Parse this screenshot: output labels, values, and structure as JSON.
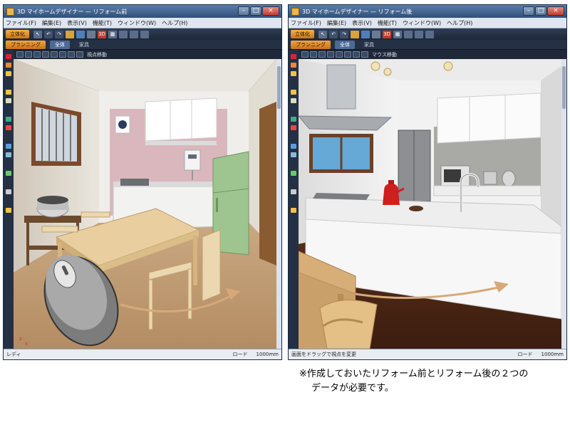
{
  "window_left": {
    "title": "3D マイホームデザイナー — リフォーム前",
    "menu": [
      "ファイル(F)",
      "編集(E)",
      "表示(V)",
      "機能(T)",
      "ウィンドウ(W)",
      "ヘルプ(H)"
    ],
    "mode_button": "立体化",
    "tabs": [
      "プランニング",
      "全体",
      "家具"
    ],
    "view_label": "視点移動",
    "status": "レディ",
    "status_mode": "ロード",
    "status_unit": "1000mm"
  },
  "window_right": {
    "title": "3D マイホームデザイナー — リフォーム後",
    "menu": [
      "ファイル(F)",
      "編集(E)",
      "表示(V)",
      "機能(T)",
      "ウィンドウ(W)",
      "ヘルプ(H)"
    ],
    "mode_button": "立体化",
    "tabs": [
      "プランニング",
      "全体",
      "家具"
    ],
    "view_label": "マウス移動",
    "status": "画面をドラッグで視点を変更",
    "status_mode": "ロード",
    "status_unit": "1000mm"
  },
  "caption": {
    "line1": "※作成しておいたリフォーム前とリフォーム後の２つの",
    "line2": "データが必要です。"
  },
  "colors": {
    "chrome_dark": "#1c2533",
    "title_blue": "#3f6592",
    "accent_orange": "#e89a32"
  }
}
